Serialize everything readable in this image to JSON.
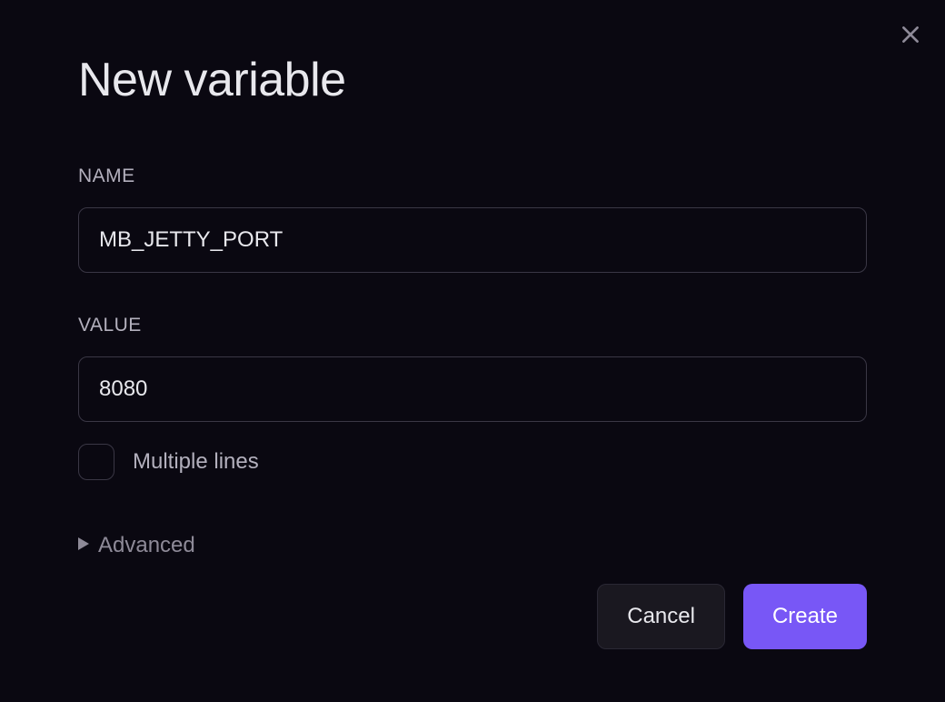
{
  "modal": {
    "title": "New variable",
    "form": {
      "name_label": "NAME",
      "name_value": "MB_JETTY_PORT",
      "value_label": "VALUE",
      "value_value": "8080",
      "multiline_label": "Multiple lines",
      "advanced_label": "Advanced"
    },
    "buttons": {
      "cancel": "Cancel",
      "create": "Create"
    }
  }
}
